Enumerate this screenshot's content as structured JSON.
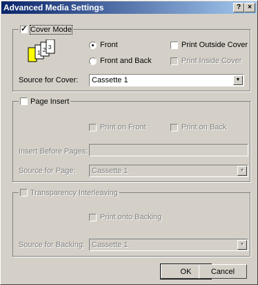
{
  "window": {
    "title": "Advanced Media Settings",
    "help_button": "?",
    "close_button": "×"
  },
  "cover": {
    "legend": "Cover Mode",
    "checked": true,
    "icon": "cover-pages-icon",
    "pages": [
      "1",
      "2",
      "3"
    ],
    "front_label": "Front",
    "front_back_label": "Front and Back",
    "print_outside_label": "Print Outside Cover",
    "print_inside_label": "Print Inside Cover",
    "source_label": "Source for Cover:",
    "source_value": "Cassette 1"
  },
  "page_insert": {
    "legend": "Page Insert",
    "checked": false,
    "print_front_label": "Print on Front",
    "print_back_label": "Print on Back",
    "insert_before_label": "Insert Before Pages:",
    "insert_before_value": "",
    "source_label": "Source for Page:",
    "source_value": "Cassette 1"
  },
  "transparency": {
    "legend": "Transparency Interleaving",
    "checked": false,
    "print_backing_label": "Print onto Backing",
    "source_label": "Source for Backing:",
    "source_value": "Cassette 1"
  },
  "buttons": {
    "ok": "OK",
    "cancel": "Cancel"
  },
  "colors": {
    "titlebar_start": "#0a246a",
    "titlebar_end": "#a6caf0",
    "face": "#d4d0c8"
  }
}
